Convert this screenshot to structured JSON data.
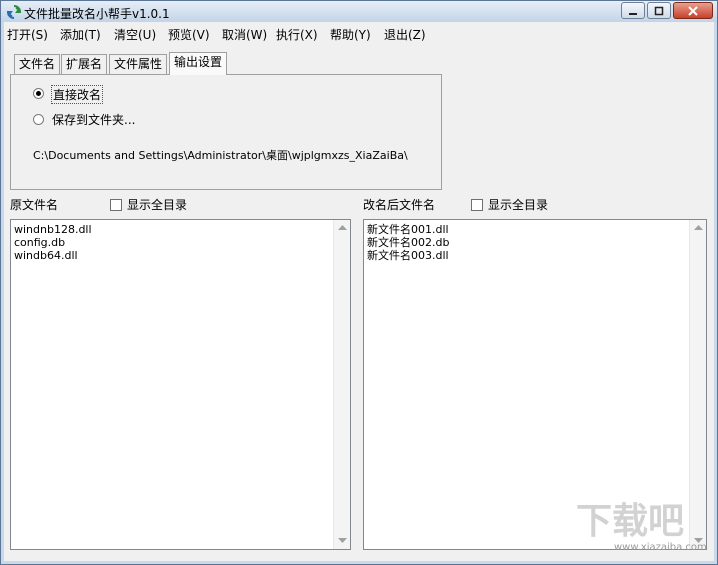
{
  "window": {
    "title": "文件批量改名小帮手v1.0.1"
  },
  "menu": [
    {
      "label": "打开(S)"
    },
    {
      "label": "添加(T)"
    },
    {
      "label": "清空(U)"
    },
    {
      "label": "预览(V)"
    },
    {
      "label": "取消(W)"
    },
    {
      "label": "执行(X)"
    },
    {
      "label": "帮助(Y)"
    },
    {
      "label": "退出(Z)"
    }
  ],
  "tabs": [
    {
      "label": "文件名"
    },
    {
      "label": "扩展名"
    },
    {
      "label": "文件属性"
    },
    {
      "label": "输出设置"
    }
  ],
  "output": {
    "option_direct": "直接改名",
    "option_folder": "保存到文件夹...",
    "path": "C:\\Documents and Settings\\Administrator\\桌面\\wjplgmxzs_XiaZaiBa\\"
  },
  "original": {
    "header": "原文件名",
    "show_all_label": "显示全目录",
    "files": [
      "windnb128.dll",
      "config.db",
      "windb64.dll"
    ]
  },
  "renamed": {
    "header": "改名后文件名",
    "show_all_label": "显示全目录",
    "files": [
      "新文件名001.dll",
      "新文件名002.db",
      "新文件名003.dll"
    ]
  },
  "watermark": {
    "brand": "下载吧",
    "url": "www.xiazaiba.com"
  },
  "colors": {
    "selected_radio": "#000000",
    "close_button": "#c7402a"
  }
}
